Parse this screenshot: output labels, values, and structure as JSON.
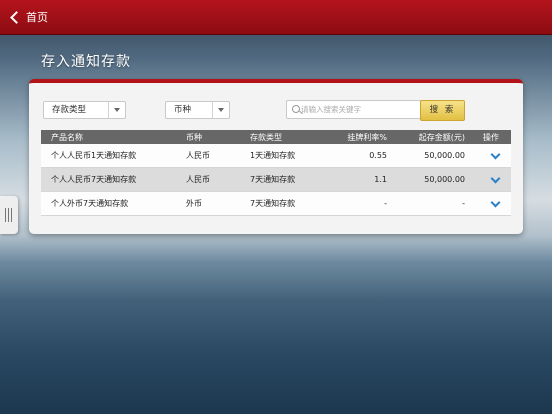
{
  "header": {
    "back_label": "首页"
  },
  "page": {
    "title": "存入通知存款"
  },
  "filters": {
    "deposit_type": {
      "selected": "存款类型"
    },
    "currency": {
      "selected": "币种"
    },
    "search": {
      "placeholder": "请输入搜索关键字",
      "value": "",
      "button_label": "搜 索"
    }
  },
  "table": {
    "columns": [
      "产品名称",
      "币种",
      "存款类型",
      "挂牌利率%",
      "起存金额(元)",
      "操作"
    ],
    "rows": [
      {
        "name": "个人人民币1天通知存款",
        "currency": "人民币",
        "type": "1天通知存款",
        "rate": "0.55",
        "min": "50,000.00"
      },
      {
        "name": "个人人民币7天通知存款",
        "currency": "人民币",
        "type": "7天通知存款",
        "rate": "1.1",
        "min": "50,000.00"
      },
      {
        "name": "个人外币7天通知存款",
        "currency": "外币",
        "type": "7天通知存款",
        "rate": "-",
        "min": "-"
      }
    ]
  },
  "icons": {
    "back": "chevron-left-icon",
    "search": "search-icon",
    "expand": "chevron-down-icon",
    "side_handle": "drag-handle-icon"
  },
  "colors": {
    "brand_red": "#b41219",
    "search_button": "#e8c84f",
    "header_row": "#676767",
    "link_blue": "#2a7fc9"
  }
}
